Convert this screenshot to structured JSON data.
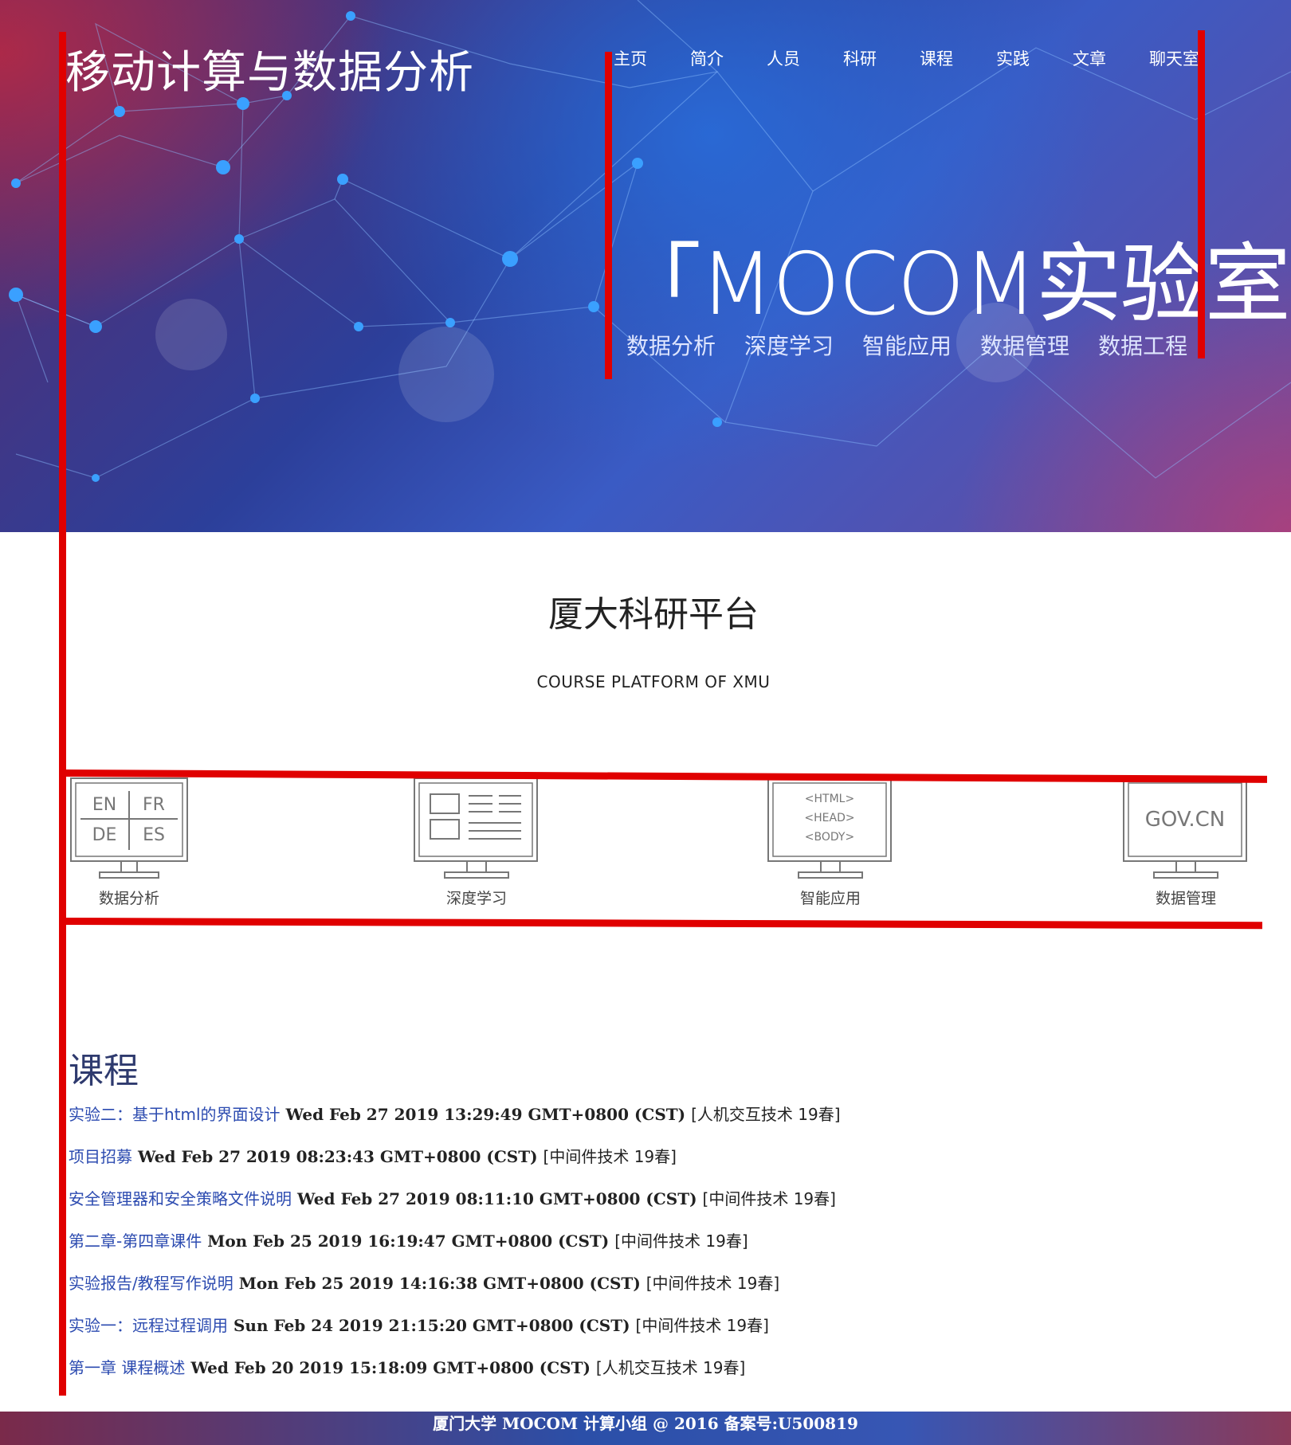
{
  "site": {
    "logo": "移动计算与数据分析",
    "nav": [
      "主页",
      "简介",
      "人员",
      "科研",
      "课程",
      "实践",
      "文章",
      "聊天室"
    ]
  },
  "hero": {
    "title": "「MOCOM实验室」",
    "tags": [
      "数据分析",
      "深度学习",
      "智能应用",
      "数据管理",
      "数据工程"
    ]
  },
  "platform": {
    "title": "厦大科研平台",
    "subtitle": "COURSE PLATFORM OF XMU",
    "features": [
      {
        "icon": "language-monitor-icon",
        "screen_text": [
          "EN",
          "FR",
          "DE",
          "ES"
        ],
        "label": "数据分析"
      },
      {
        "icon": "layout-monitor-icon",
        "label": "深度学习"
      },
      {
        "icon": "html-monitor-icon",
        "screen_text": [
          "<HTML>",
          "<HEAD>",
          "<BODY>"
        ],
        "label": "智能应用"
      },
      {
        "icon": "gov-monitor-icon",
        "screen_text": [
          "GOV.CN"
        ],
        "label": "数据管理"
      }
    ]
  },
  "courses": {
    "heading": "课程",
    "items": [
      {
        "title": "实验二：基于html的界面设计",
        "date": "Wed Feb 27 2019 13:29:49 GMT+0800 (CST)",
        "category": "[人机交互技术 19春]"
      },
      {
        "title": "项目招募",
        "date": "Wed Feb 27 2019 08:23:43 GMT+0800 (CST)",
        "category": "[中间件技术 19春]"
      },
      {
        "title": "安全管理器和安全策略文件说明",
        "date": "Wed Feb 27 2019 08:11:10 GMT+0800 (CST)",
        "category": "[中间件技术 19春]"
      },
      {
        "title": "第二章-第四章课件",
        "date": "Mon Feb 25 2019 16:19:47 GMT+0800 (CST)",
        "category": "[中间件技术 19春]"
      },
      {
        "title": "实验报告/教程写作说明",
        "date": "Mon Feb 25 2019 14:16:38 GMT+0800 (CST)",
        "category": "[中间件技术 19春]"
      },
      {
        "title": "实验一：远程过程调用",
        "date": "Sun Feb 24 2019 21:15:20 GMT+0800 (CST)",
        "category": "[中间件技术 19春]"
      },
      {
        "title": "第一章 课程概述",
        "date": "Wed Feb 20 2019 15:18:09 GMT+0800 (CST)",
        "category": "[人机交互技术 19春]"
      }
    ]
  },
  "footer": {
    "text": "厦门大学 MOCOM 计算小组 @ 2016 备案号:U500819"
  },
  "colors": {
    "annotation_red": "#e00000",
    "link_blue": "#2c4bb0",
    "heading_navy": "#2e3a6e"
  }
}
